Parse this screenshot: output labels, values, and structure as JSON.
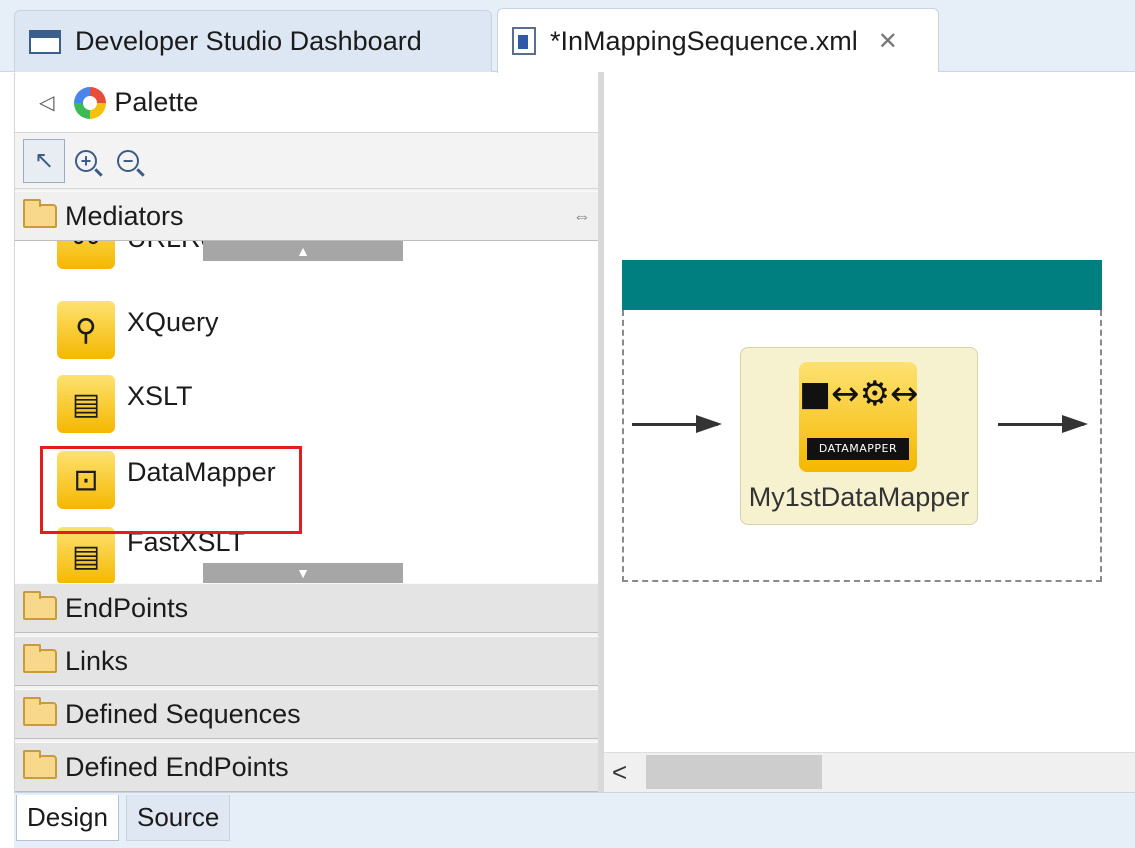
{
  "editor_tabs": [
    {
      "label": "Developer Studio Dashboard",
      "icon": "window-icon",
      "active": false
    },
    {
      "label": "*InMappingSequence.xml",
      "icon": "xml-file-icon",
      "active": true,
      "close": "✕"
    }
  ],
  "palette": {
    "title": "Palette",
    "collapse_glyph": "◁",
    "tools": {
      "select": "↖",
      "zoom_in": "+",
      "zoom_out": "−"
    },
    "mediators_label": "Mediators",
    "pin_glyph": "⇔",
    "mediators": [
      {
        "label": "URLRewrite",
        "glyph": "⚯"
      },
      {
        "label": "XQuery",
        "glyph": "⚲"
      },
      {
        "label": "XSLT",
        "glyph": "▤"
      },
      {
        "label": "DataMapper",
        "glyph": "⊡"
      },
      {
        "label": "FastXSLT",
        "glyph": "▤"
      }
    ],
    "scroll_up": "▲",
    "scroll_down": "▼",
    "drawers": [
      "EndPoints",
      "Links",
      "Defined Sequences",
      "Defined EndPoints"
    ]
  },
  "canvas": {
    "node": {
      "caption": "DATAMAPPER",
      "name": "My1stDataMapper",
      "glyph": "■↔⚙↔■"
    },
    "sequence_bar_color": "#007f81",
    "hscroll_left": "<"
  },
  "bottom_tabs": {
    "design": "Design",
    "source": "Source"
  },
  "colors": {
    "highlight": "#e31c1c",
    "mediator_icon": "#f5b700"
  }
}
